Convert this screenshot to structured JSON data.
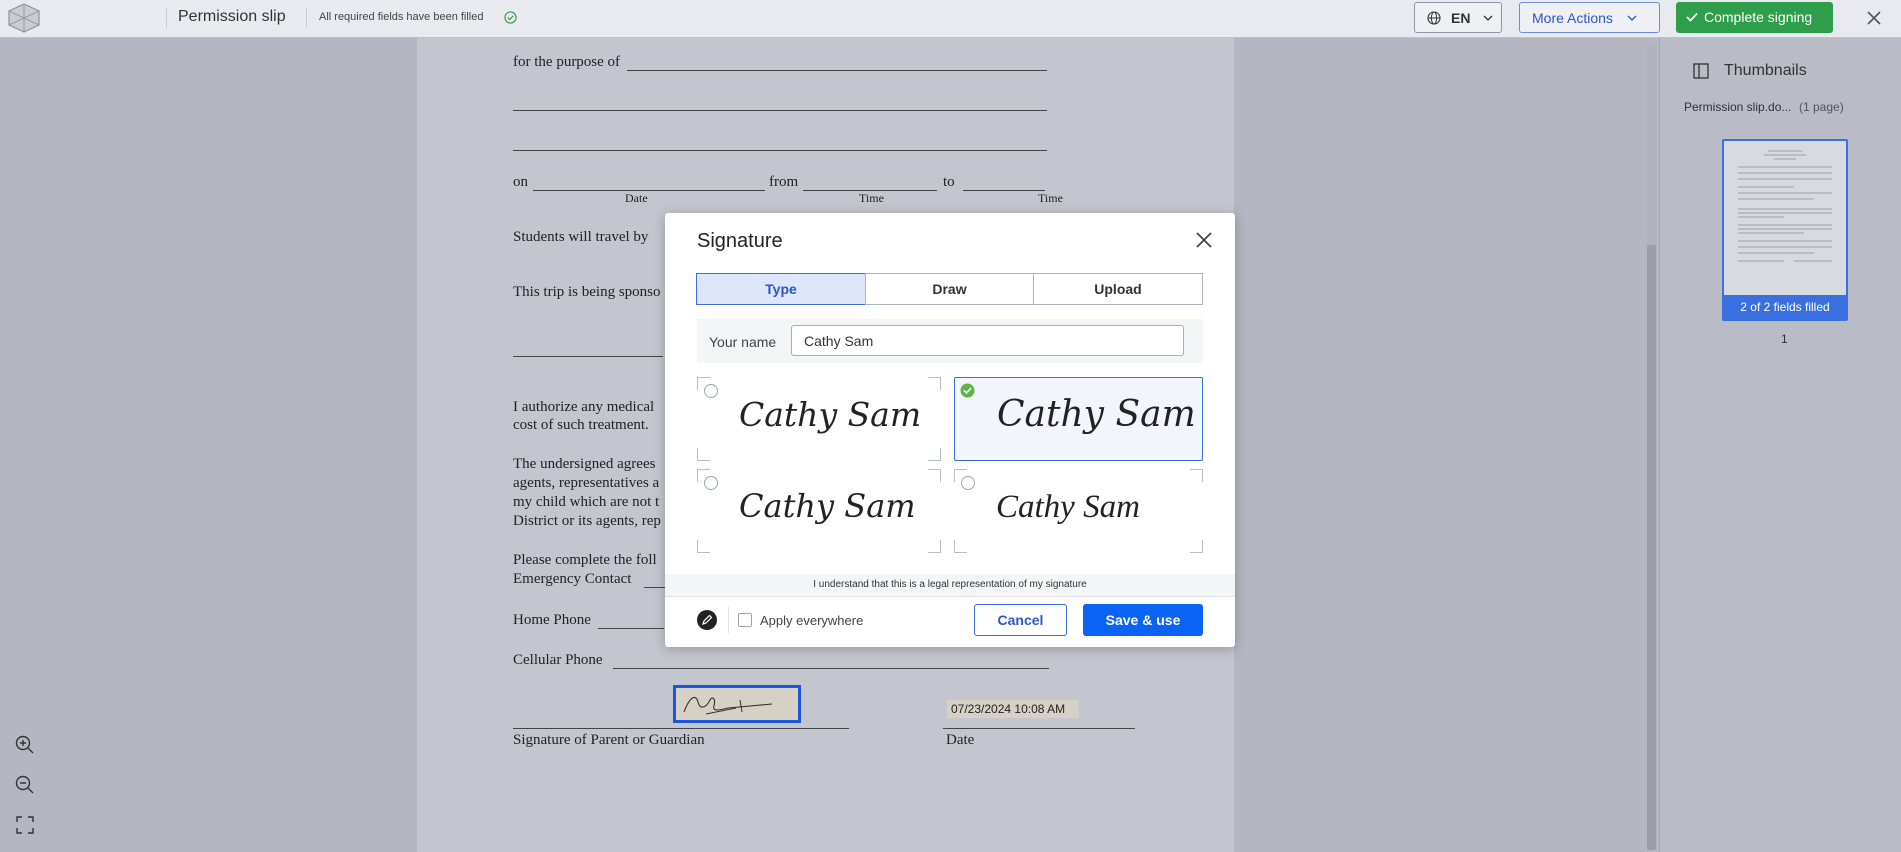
{
  "topbar": {
    "title": "Permission slip",
    "status": "All required fields have been filled",
    "language": "EN",
    "more_actions": "More Actions",
    "complete_signing": "Complete signing"
  },
  "document": {
    "purpose_label": "for the purpose of",
    "on_label": "on",
    "from_label": "from",
    "to_label": "to",
    "date_caption": "Date",
    "time_caption_1": "Time",
    "time_caption_2": "Time",
    "travel_label": "Students will travel by",
    "sponsor_label": "This trip is being sponso",
    "authorize_line1": "I authorize any medical",
    "authorize_line2": "cost of such treatment.",
    "undersigned_line1": "The undersigned agrees",
    "undersigned_line2": "agents, representatives a",
    "undersigned_line3": "my child which are not t",
    "undersigned_line4": "District or its agents, rep",
    "complete_line1": "Please complete the foll",
    "complete_line2": "Emergency Contact",
    "home_phone": "Home Phone",
    "cell_phone": "Cellular Phone",
    "date_value": "07/23/2024 10:08 AM",
    "sig_caption": "Signature of Parent or Guardian",
    "date_field_caption": "Date"
  },
  "thumbnails": {
    "title": "Thumbnails",
    "file_name": "Permission slip.do...",
    "page_count": "(1 page)",
    "fields_badge": "2 of 2 fields filled",
    "page_number": "1"
  },
  "modal": {
    "title": "Signature",
    "tabs": [
      "Type",
      "Draw",
      "Upload"
    ],
    "name_label": "Your name",
    "name_value": "Cathy Sam",
    "signature_options": [
      "Cathy Sam",
      "Cathy Sam",
      "Cathy Sam",
      "Cathy Sam"
    ],
    "selected_option": 2,
    "legal_text": "I understand that this is a legal representation of my signature",
    "apply_everywhere": "Apply everywhere",
    "cancel": "Cancel",
    "save": "Save & use"
  },
  "colors": {
    "accent": "#3a6fe2",
    "primary_button": "#0b63f6",
    "success": "#2e9e4b"
  }
}
